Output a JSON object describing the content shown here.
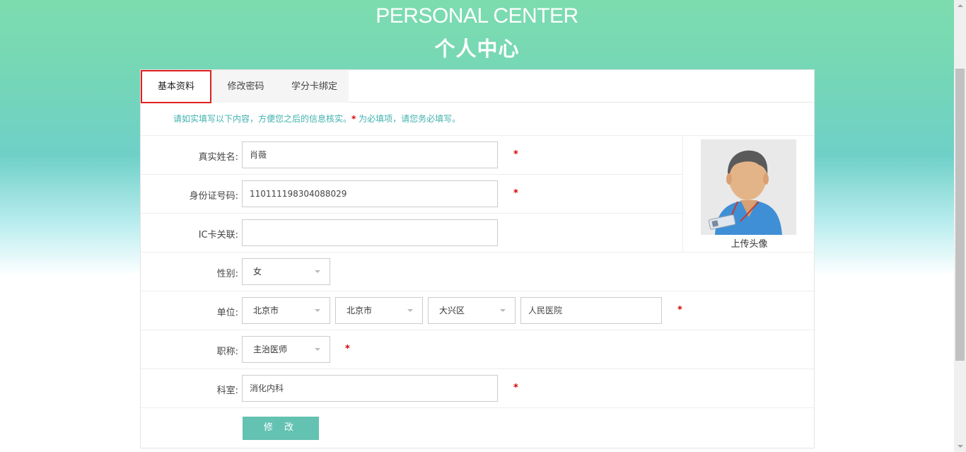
{
  "header": {
    "title_en": "PERSONAL CENTER",
    "title_cn": "个人中心"
  },
  "tabs": [
    {
      "label": "基本资料",
      "active": true
    },
    {
      "label": "修改密码",
      "active": false
    },
    {
      "label": "学分卡绑定",
      "active": false
    }
  ],
  "notice": {
    "text_before": "请如实填写以下内容，方便您之后的信息核实。",
    "star": "*",
    "text_after": " 为必填项，请您务必填写。"
  },
  "form": {
    "name": {
      "label": "真实姓名:",
      "value": "肖薇",
      "required": "*"
    },
    "id_number": {
      "label": "身份证号码:",
      "value": "110111198304088029",
      "required": "*"
    },
    "ic_card": {
      "label": "IC卡关联:",
      "value": ""
    },
    "gender": {
      "label": "性别:",
      "value": "女"
    },
    "unit": {
      "label": "单位:",
      "province": "北京市",
      "city": "北京市",
      "district": "大兴区",
      "hospital": "人民医院",
      "required": "*"
    },
    "title": {
      "label": "职称:",
      "value": "主治医师",
      "required": "*"
    },
    "department": {
      "label": "科室:",
      "value": "消化内科",
      "required": "*"
    }
  },
  "avatar": {
    "upload_label": "上传头像"
  },
  "submit_label": "修 改",
  "colors": {
    "accent": "#64c2b2",
    "notice": "#3fb1ad",
    "required": "#d40000",
    "active_tab_border": "#e02020"
  }
}
